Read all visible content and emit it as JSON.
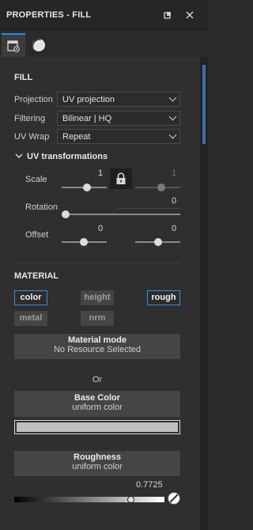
{
  "header": {
    "title": "PROPERTIES - FILL"
  },
  "tabs": [
    {
      "icon": "texture-settings-icon",
      "active": true
    },
    {
      "icon": "material-sphere-icon",
      "active": false
    }
  ],
  "fill": {
    "section_title": "FILL",
    "projection_label": "Projection",
    "projection_value": "UV projection",
    "filtering_label": "Filtering",
    "filtering_value": "Bilinear | HQ",
    "uvwrap_label": "UV Wrap",
    "uvwrap_value": "Repeat"
  },
  "uv_transformations": {
    "title": "UV transformations",
    "scale_label": "Scale",
    "scale_x": "1",
    "scale_y": "1",
    "scale_locked": true,
    "rotation_label": "Rotation",
    "rotation_value": "0",
    "offset_label": "Offset",
    "offset_x": "0",
    "offset_y": "0"
  },
  "material": {
    "section_title": "MATERIAL",
    "channels": [
      {
        "label": "color",
        "active": true
      },
      {
        "label": "height",
        "active": false
      },
      {
        "label": "rough",
        "active": true
      },
      {
        "label": "metal",
        "active": false
      },
      {
        "label": "nrm",
        "active": false
      }
    ],
    "material_mode_title": "Material mode",
    "material_mode_value": "No Resource Selected",
    "or_label": "Or",
    "base_color_title": "Base Color",
    "base_color_mode": "uniform color",
    "base_color_value": "#c0c0c0",
    "roughness_title": "Roughness",
    "roughness_mode": "uniform color",
    "roughness_value": "0.7725"
  },
  "colors": {
    "accent": "#3a8fe0",
    "panel_bg": "#2f2f2f"
  }
}
